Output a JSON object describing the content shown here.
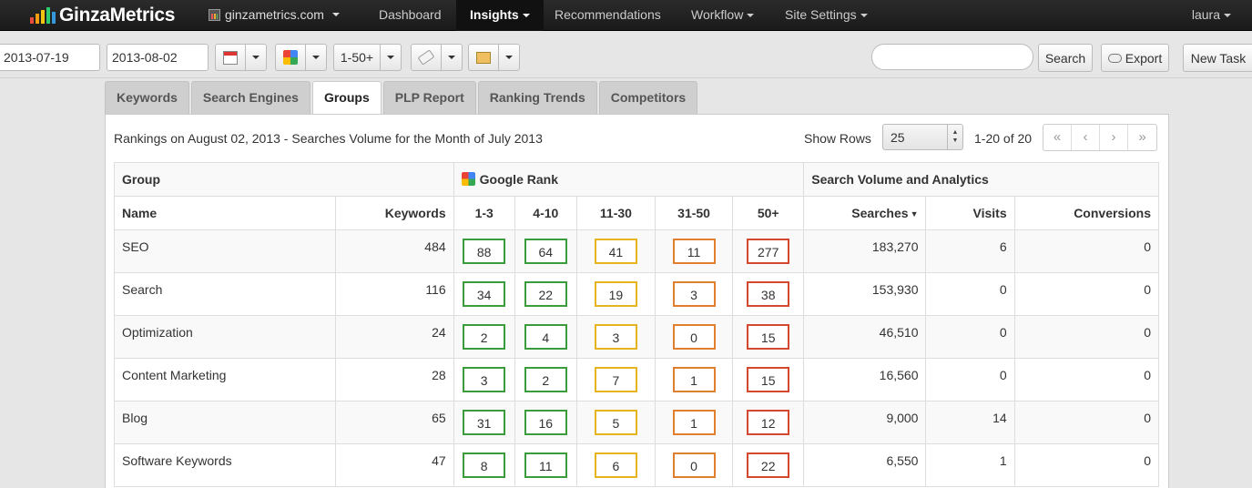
{
  "app": {
    "logo_text": "GinzaMetrics",
    "site": "ginzametrics.com",
    "user": "laura",
    "nav": [
      {
        "label": "Dashboard",
        "active": false
      },
      {
        "label": "Insights",
        "active": true
      },
      {
        "label": "Recommendations",
        "active": false
      },
      {
        "label": "Workflow",
        "active": false
      },
      {
        "label": "Site Settings",
        "active": false
      }
    ],
    "brand_colors": [
      "#e84c3d",
      "#f39c12",
      "#f1c40f",
      "#2ecc71",
      "#3498db"
    ]
  },
  "toolbar": {
    "start_date": "2013-07-19",
    "end_date": "2013-08-02",
    "rank_range": "1-50+",
    "search_value": "",
    "search_button": "Search",
    "export_button": "Export",
    "new_task_button": "New Task",
    "icons": [
      "calendar-icon",
      "google-icon",
      "tag-icon",
      "notes-icon",
      "cloud-icon"
    ]
  },
  "tabs": [
    {
      "label": "Keywords",
      "active": false
    },
    {
      "label": "Search Engines",
      "active": false
    },
    {
      "label": "Groups",
      "active": true
    },
    {
      "label": "PLP Report",
      "active": false
    },
    {
      "label": "Ranking Trends",
      "active": false
    },
    {
      "label": "Competitors",
      "active": false
    }
  ],
  "panel": {
    "title": "Rankings on August 02, 2013 - Searches Volume for the Month of July 2013",
    "show_rows_label": "Show Rows",
    "rows_value": "25",
    "range_text": "1-20 of 20",
    "pager": [
      "«",
      "‹",
      "›",
      "»"
    ]
  },
  "table": {
    "group_headers": {
      "group": "Group",
      "google_rank": "Google Rank",
      "search_volume": "Search Volume and Analytics"
    },
    "columns": {
      "name": "Name",
      "keywords": "Keywords",
      "r1": "1-3",
      "r2": "4-10",
      "r3": "11-30",
      "r4": "31-50",
      "r5": "50+",
      "searches": "Searches",
      "visits": "Visits",
      "conversions": "Conversions"
    },
    "rank_colors": {
      "r1": "#3a9c3a",
      "r2": "#3a9c3a",
      "r3": "#e6b41e",
      "r4": "#e07f2e",
      "r5": "#d3482e"
    },
    "rows": [
      {
        "name": "SEO",
        "keywords": "484",
        "r1": "88",
        "r2": "64",
        "r3": "41",
        "r4": "11",
        "r5": "277",
        "searches": "183,270",
        "visits": "6",
        "conversions": "0"
      },
      {
        "name": "Search",
        "keywords": "116",
        "r1": "34",
        "r2": "22",
        "r3": "19",
        "r4": "3",
        "r5": "38",
        "searches": "153,930",
        "visits": "0",
        "conversions": "0"
      },
      {
        "name": "Optimization",
        "keywords": "24",
        "r1": "2",
        "r2": "4",
        "r3": "3",
        "r4": "0",
        "r5": "15",
        "searches": "46,510",
        "visits": "0",
        "conversions": "0"
      },
      {
        "name": "Content Marketing",
        "keywords": "28",
        "r1": "3",
        "r2": "2",
        "r3": "7",
        "r4": "1",
        "r5": "15",
        "searches": "16,560",
        "visits": "0",
        "conversions": "0"
      },
      {
        "name": "Blog",
        "keywords": "65",
        "r1": "31",
        "r2": "16",
        "r3": "5",
        "r4": "1",
        "r5": "12",
        "searches": "9,000",
        "visits": "14",
        "conversions": "0"
      },
      {
        "name": "Software Keywords",
        "keywords": "47",
        "r1": "8",
        "r2": "11",
        "r3": "6",
        "r4": "0",
        "r5": "22",
        "searches": "6,550",
        "visits": "1",
        "conversions": "0"
      }
    ]
  }
}
